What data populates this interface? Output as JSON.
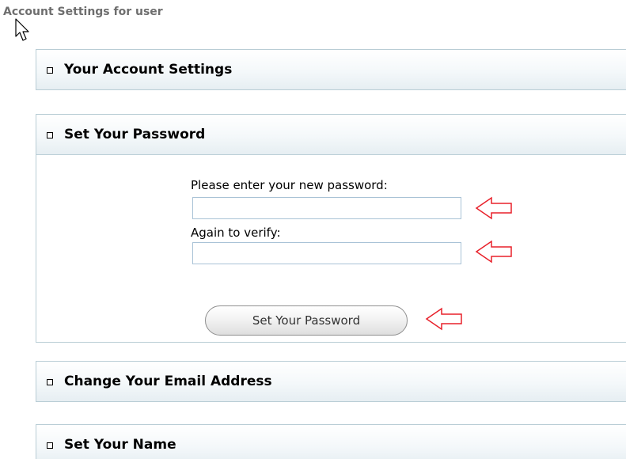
{
  "page": {
    "title": "Account Settings for user"
  },
  "sections": [
    {
      "label": "Your Account Settings"
    },
    {
      "label": "Set Your Password"
    },
    {
      "label": "Change Your Email Address"
    },
    {
      "label": "Set Your Name"
    }
  ],
  "password_form": {
    "new_password_label": "Please enter your new password:",
    "new_password_value": "",
    "verify_label": "Again to verify:",
    "verify_value": "",
    "submit_label": "Set Your Password"
  },
  "icons": {
    "bullet": "square-bullet-icon",
    "annotation": "red-outline-left-arrow-icon",
    "pointer": "mouse-cursor-icon"
  },
  "colors": {
    "annotation_arrow": "#e8202a",
    "section_border": "#b9cdd5",
    "title_text": "#6e6e6e"
  }
}
